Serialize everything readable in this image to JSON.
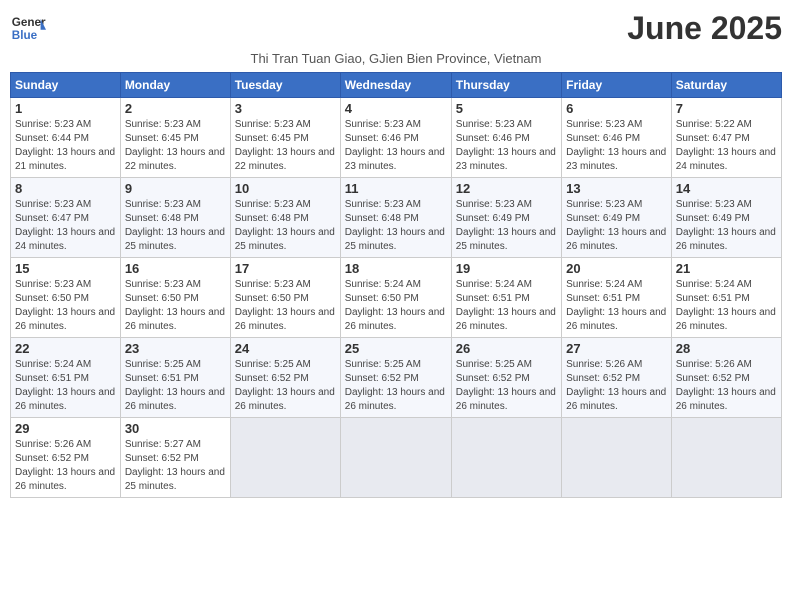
{
  "header": {
    "logo_line1": "General",
    "logo_line2": "Blue",
    "month_title": "June 2025",
    "subtitle": "Thi Tran Tuan Giao, GJien Bien Province, Vietnam"
  },
  "days_of_week": [
    "Sunday",
    "Monday",
    "Tuesday",
    "Wednesday",
    "Thursday",
    "Friday",
    "Saturday"
  ],
  "weeks": [
    [
      {
        "num": "1",
        "sunrise": "5:23 AM",
        "sunset": "6:44 PM",
        "daylight": "13 hours and 21 minutes."
      },
      {
        "num": "2",
        "sunrise": "5:23 AM",
        "sunset": "6:45 PM",
        "daylight": "13 hours and 22 minutes."
      },
      {
        "num": "3",
        "sunrise": "5:23 AM",
        "sunset": "6:45 PM",
        "daylight": "13 hours and 22 minutes."
      },
      {
        "num": "4",
        "sunrise": "5:23 AM",
        "sunset": "6:46 PM",
        "daylight": "13 hours and 23 minutes."
      },
      {
        "num": "5",
        "sunrise": "5:23 AM",
        "sunset": "6:46 PM",
        "daylight": "13 hours and 23 minutes."
      },
      {
        "num": "6",
        "sunrise": "5:23 AM",
        "sunset": "6:46 PM",
        "daylight": "13 hours and 23 minutes."
      },
      {
        "num": "7",
        "sunrise": "5:22 AM",
        "sunset": "6:47 PM",
        "daylight": "13 hours and 24 minutes."
      }
    ],
    [
      {
        "num": "8",
        "sunrise": "5:23 AM",
        "sunset": "6:47 PM",
        "daylight": "13 hours and 24 minutes."
      },
      {
        "num": "9",
        "sunrise": "5:23 AM",
        "sunset": "6:48 PM",
        "daylight": "13 hours and 25 minutes."
      },
      {
        "num": "10",
        "sunrise": "5:23 AM",
        "sunset": "6:48 PM",
        "daylight": "13 hours and 25 minutes."
      },
      {
        "num": "11",
        "sunrise": "5:23 AM",
        "sunset": "6:48 PM",
        "daylight": "13 hours and 25 minutes."
      },
      {
        "num": "12",
        "sunrise": "5:23 AM",
        "sunset": "6:49 PM",
        "daylight": "13 hours and 25 minutes."
      },
      {
        "num": "13",
        "sunrise": "5:23 AM",
        "sunset": "6:49 PM",
        "daylight": "13 hours and 26 minutes."
      },
      {
        "num": "14",
        "sunrise": "5:23 AM",
        "sunset": "6:49 PM",
        "daylight": "13 hours and 26 minutes."
      }
    ],
    [
      {
        "num": "15",
        "sunrise": "5:23 AM",
        "sunset": "6:50 PM",
        "daylight": "13 hours and 26 minutes."
      },
      {
        "num": "16",
        "sunrise": "5:23 AM",
        "sunset": "6:50 PM",
        "daylight": "13 hours and 26 minutes."
      },
      {
        "num": "17",
        "sunrise": "5:23 AM",
        "sunset": "6:50 PM",
        "daylight": "13 hours and 26 minutes."
      },
      {
        "num": "18",
        "sunrise": "5:24 AM",
        "sunset": "6:50 PM",
        "daylight": "13 hours and 26 minutes."
      },
      {
        "num": "19",
        "sunrise": "5:24 AM",
        "sunset": "6:51 PM",
        "daylight": "13 hours and 26 minutes."
      },
      {
        "num": "20",
        "sunrise": "5:24 AM",
        "sunset": "6:51 PM",
        "daylight": "13 hours and 26 minutes."
      },
      {
        "num": "21",
        "sunrise": "5:24 AM",
        "sunset": "6:51 PM",
        "daylight": "13 hours and 26 minutes."
      }
    ],
    [
      {
        "num": "22",
        "sunrise": "5:24 AM",
        "sunset": "6:51 PM",
        "daylight": "13 hours and 26 minutes."
      },
      {
        "num": "23",
        "sunrise": "5:25 AM",
        "sunset": "6:51 PM",
        "daylight": "13 hours and 26 minutes."
      },
      {
        "num": "24",
        "sunrise": "5:25 AM",
        "sunset": "6:52 PM",
        "daylight": "13 hours and 26 minutes."
      },
      {
        "num": "25",
        "sunrise": "5:25 AM",
        "sunset": "6:52 PM",
        "daylight": "13 hours and 26 minutes."
      },
      {
        "num": "26",
        "sunrise": "5:25 AM",
        "sunset": "6:52 PM",
        "daylight": "13 hours and 26 minutes."
      },
      {
        "num": "27",
        "sunrise": "5:26 AM",
        "sunset": "6:52 PM",
        "daylight": "13 hours and 26 minutes."
      },
      {
        "num": "28",
        "sunrise": "5:26 AM",
        "sunset": "6:52 PM",
        "daylight": "13 hours and 26 minutes."
      }
    ],
    [
      {
        "num": "29",
        "sunrise": "5:26 AM",
        "sunset": "6:52 PM",
        "daylight": "13 hours and 26 minutes."
      },
      {
        "num": "30",
        "sunrise": "5:27 AM",
        "sunset": "6:52 PM",
        "daylight": "13 hours and 25 minutes."
      },
      null,
      null,
      null,
      null,
      null
    ]
  ]
}
